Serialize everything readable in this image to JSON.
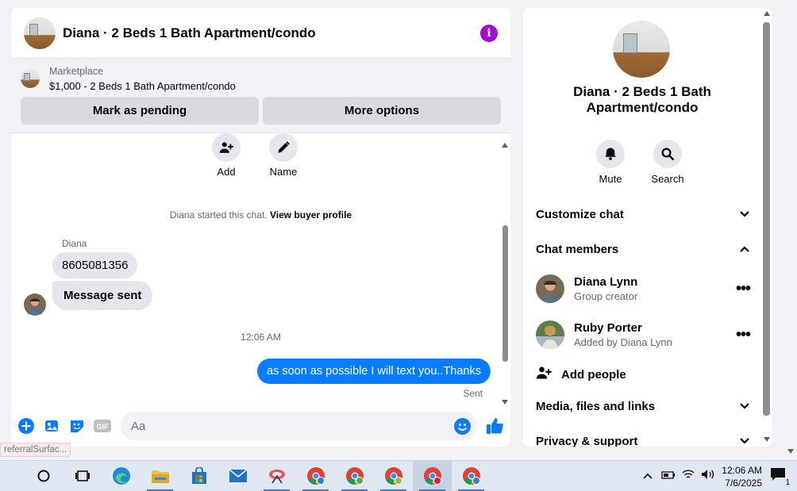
{
  "chat": {
    "title": "Diana · 2 Beds 1 Bath Apartment/condo",
    "marketplace_label": "Marketplace",
    "listing": "$1,000 - 2 Beds 1 Bath Apartment/condo",
    "mark_pending_label": "Mark as pending",
    "more_options_label": "More options",
    "quick_actions": [
      {
        "label": "Add",
        "icon": "add-person-icon"
      },
      {
        "label": "Name",
        "icon": "pencil-icon"
      }
    ],
    "system_message": "Diana started this chat.",
    "system_link": "View buyer profile",
    "sender_name": "Diana",
    "incoming": [
      "8605081356",
      "Message sent"
    ],
    "timestamp": "12:06 AM",
    "outgoing": "as soon as possible I will text you..Thanks",
    "sent_status": "Sent",
    "input_placeholder": "Aa",
    "accent_color": "#0a7cff"
  },
  "tooltip": "referralSurfac...",
  "info": {
    "title": "Diana · 2 Beds 1 Bath Apartment/condo",
    "mute_label": "Mute",
    "search_label": "Search",
    "customize_chat": "Customize chat",
    "chat_members": "Chat members",
    "members": [
      {
        "name": "Diana Lynn",
        "subtitle": "Group creator"
      },
      {
        "name": "Ruby Porter",
        "subtitle": "Added by Diana Lynn"
      }
    ],
    "add_people": "Add people",
    "media_files_links": "Media, files and links",
    "privacy_support": "Privacy & support"
  },
  "taskbar": {
    "time": "12:06 AM",
    "date": "7/6/2025",
    "notification_count": "1",
    "apps": [
      "cortana-icon",
      "task-view-icon",
      "edge-icon",
      "file-explorer-icon",
      "store-icon",
      "mail-icon",
      "snip-icon",
      "chrome-icon",
      "chrome-icon",
      "chrome-icon",
      "chrome-icon",
      "chrome-icon"
    ]
  }
}
